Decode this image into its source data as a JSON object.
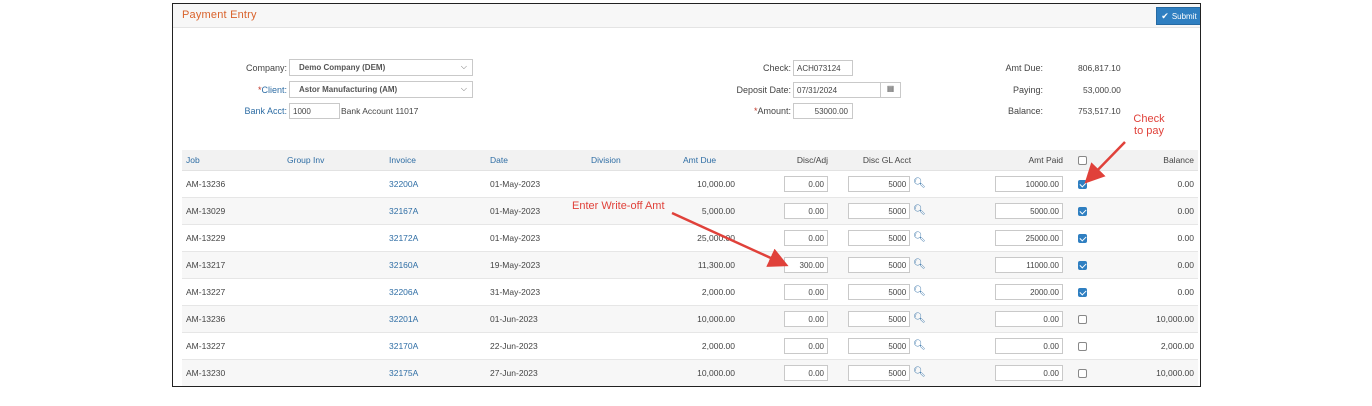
{
  "title": "Payment Entry",
  "submit_label": "Submit",
  "form": {
    "company_label": "Company:",
    "company_value": "Demo Company (DEM)",
    "client_req": "*",
    "client_label": "Client:",
    "client_value": "Astor Manufacturing (AM)",
    "bank_label": "Bank Acct:",
    "bank_value": "1000",
    "bank_name": "Bank Account 11017",
    "check_label": "Check:",
    "check_value": "ACH073124",
    "deposit_label": "Deposit Date:",
    "deposit_value": "07/31/2024",
    "amount_req": "*",
    "amount_label": "Amount:",
    "amount_value": "53000.00"
  },
  "summary": {
    "due_label": "Amt Due:",
    "due_value": "806,817.10",
    "paying_label": "Paying:",
    "paying_value": "53,000.00",
    "balance_label": "Balance:",
    "balance_value": "753,517.10"
  },
  "columns": {
    "job": "Job",
    "group_inv": "Group Inv",
    "invoice": "Invoice",
    "date": "Date",
    "division": "Division",
    "amt_due": "Amt Due",
    "disc_adj": "Disc/Adj",
    "disc_gl": "Disc GL Acct",
    "amt_paid": "Amt Paid",
    "balance": "Balance"
  },
  "rows": [
    {
      "job": "AM-13236",
      "invoice": "32200A",
      "date": "01-May-2023",
      "amt_due": "10,000.00",
      "disc": "0.00",
      "gl": "5000",
      "paid": "10000.00",
      "checked": true,
      "balance": "0.00"
    },
    {
      "job": "AM-13029",
      "invoice": "32167A",
      "date": "01-May-2023",
      "amt_due": "5,000.00",
      "disc": "0.00",
      "gl": "5000",
      "paid": "5000.00",
      "checked": true,
      "balance": "0.00"
    },
    {
      "job": "AM-13229",
      "invoice": "32172A",
      "date": "01-May-2023",
      "amt_due": "25,000.00",
      "disc": "0.00",
      "gl": "5000",
      "paid": "25000.00",
      "checked": true,
      "balance": "0.00"
    },
    {
      "job": "AM-13217",
      "invoice": "32160A",
      "date": "19-May-2023",
      "amt_due": "11,300.00",
      "disc": "300.00",
      "gl": "5000",
      "paid": "11000.00",
      "checked": true,
      "balance": "0.00"
    },
    {
      "job": "AM-13227",
      "invoice": "32206A",
      "date": "31-May-2023",
      "amt_due": "2,000.00",
      "disc": "0.00",
      "gl": "5000",
      "paid": "2000.00",
      "checked": true,
      "balance": "0.00"
    },
    {
      "job": "AM-13236",
      "invoice": "32201A",
      "date": "01-Jun-2023",
      "amt_due": "10,000.00",
      "disc": "0.00",
      "gl": "5000",
      "paid": "0.00",
      "checked": false,
      "balance": "10,000.00"
    },
    {
      "job": "AM-13227",
      "invoice": "32170A",
      "date": "22-Jun-2023",
      "amt_due": "2,000.00",
      "disc": "0.00",
      "gl": "5000",
      "paid": "0.00",
      "checked": false,
      "balance": "2,000.00"
    },
    {
      "job": "AM-13230",
      "invoice": "32175A",
      "date": "27-Jun-2023",
      "amt_due": "10,000.00",
      "disc": "0.00",
      "gl": "5000",
      "paid": "0.00",
      "checked": false,
      "balance": "10,000.00"
    }
  ],
  "annotations": {
    "writeoff": "Enter Write-off Amt",
    "check_line1": "Check",
    "check_line2": "to pay"
  },
  "colors": {
    "accent": "#2f7fc1",
    "title": "#d9622b",
    "annotation": "#e0413a"
  },
  "icons": {
    "submit": "check-icon",
    "deposit": "calendar-icon",
    "gl_lookup": "search-icon"
  }
}
